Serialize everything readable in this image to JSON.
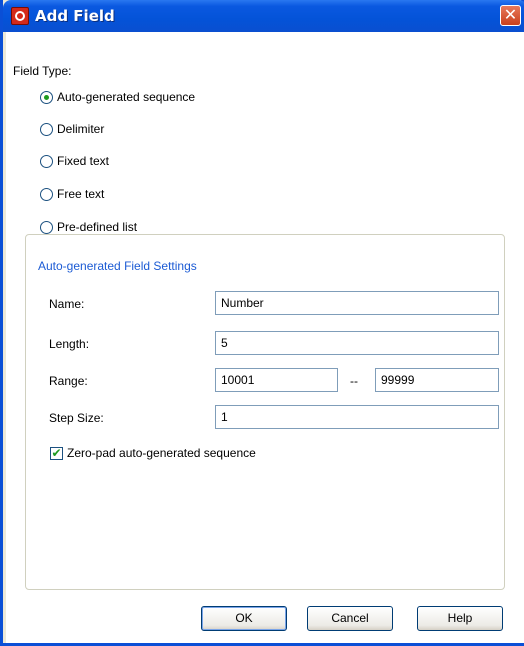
{
  "window": {
    "title": "Add Field",
    "close_glyph": "✕"
  },
  "field_type": {
    "label": "Field Type:",
    "options": [
      {
        "label": "Auto-generated sequence",
        "selected": true
      },
      {
        "label": "Delimiter",
        "selected": false
      },
      {
        "label": "Fixed text",
        "selected": false
      },
      {
        "label": "Free text",
        "selected": false
      },
      {
        "label": "Pre-defined list",
        "selected": false
      }
    ]
  },
  "settings": {
    "title": "Auto-generated Field Settings",
    "name_label": "Name:",
    "name_value": "Number",
    "length_label": "Length:",
    "length_value": "5",
    "range_label": "Range:",
    "range_from": "10001",
    "range_sep": "--",
    "range_to": "99999",
    "step_label": "Step Size:",
    "step_value": "1",
    "zero_pad_label": "Zero-pad auto-generated sequence",
    "zero_pad_checked": true,
    "check_glyph": "✔"
  },
  "buttons": {
    "ok": "OK",
    "cancel": "Cancel",
    "help": "Help"
  },
  "colors": {
    "titlebar": "#0453d8",
    "group_title": "#1c5bd4",
    "check": "#1e9a1e"
  }
}
